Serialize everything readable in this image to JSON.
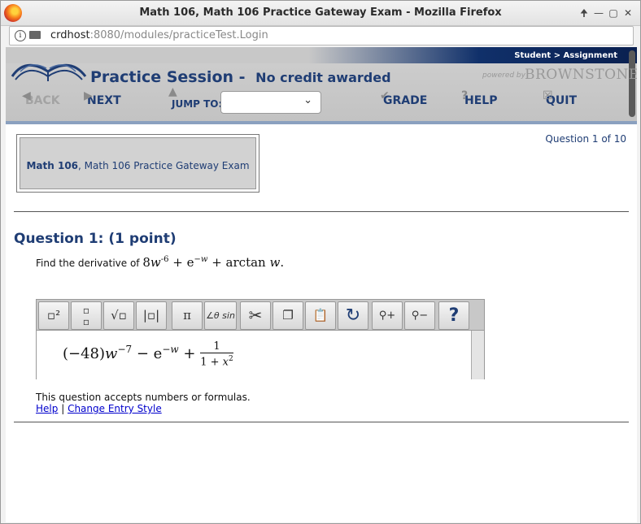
{
  "window": {
    "title": "Math 106, Math 106 Practice Gateway Exam - Mozilla Firefox"
  },
  "urlbar": {
    "host": "crdhost",
    "path": ":8080/modules/practiceTest.Login"
  },
  "header": {
    "breadcrumb": "Student > Assignment",
    "session_title": "Practice Session",
    "separator": "-",
    "credit_note": "No credit awarded",
    "powered_by": "powered by",
    "brand": "BROWNSTONE"
  },
  "nav": {
    "back": "BACK",
    "next": "NEXT",
    "jump_to": "JUMP TO:",
    "jump_value": "",
    "grade": "GRADE",
    "help": "HELP",
    "quit": "QUIT"
  },
  "question_counter": "Question 1 of 10",
  "course": {
    "code": "Math 106",
    "name": ", Math 106 Practice Gateway Exam"
  },
  "question": {
    "title": "Question 1: (1 point)",
    "prompt": "Find the derivative of"
  },
  "editor": {
    "tools": [
      "superscript",
      "fraction",
      "square-root",
      "absolute-value",
      "pi",
      "angle-trig",
      "cut",
      "copy",
      "paste",
      "redo",
      "zoom-in",
      "zoom-out",
      "help"
    ]
  },
  "note": "This question accepts numbers or formulas.",
  "links": {
    "help": "Help",
    "separator": "|",
    "change_style": "Change Entry Style"
  }
}
